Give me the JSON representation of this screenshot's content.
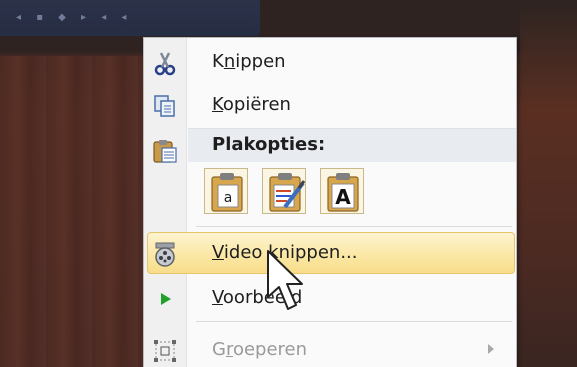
{
  "menu": {
    "items": [
      {
        "label": "Knippen",
        "icon": "scissors-icon",
        "enabled": true
      },
      {
        "label": "Kopiëren",
        "icon": "copy-icon",
        "enabled": true
      },
      {
        "label": "Plakopties:",
        "icon": "clipboard-icon",
        "enabled": true
      },
      {
        "label": "Video knippen...",
        "icon": "video-trim-icon",
        "enabled": true,
        "highlighted": true
      },
      {
        "label": "Voorbeeld",
        "icon": "play-icon",
        "enabled": true
      },
      {
        "label": "Groeperen",
        "icon": "group-icon",
        "enabled": false,
        "has_submenu": true
      }
    ],
    "paste_options": [
      {
        "name": "paste-use-destination-theme",
        "glyph": "a"
      },
      {
        "name": "paste-keep-source-formatting",
        "glyph": "brush"
      },
      {
        "name": "paste-keep-text-only",
        "glyph": "A"
      }
    ]
  },
  "colors": {
    "highlight_top": "#fdf3cf",
    "highlight_bottom": "#f8dd8a",
    "highlight_border": "#e8c56a",
    "play_green": "#22a12a"
  }
}
